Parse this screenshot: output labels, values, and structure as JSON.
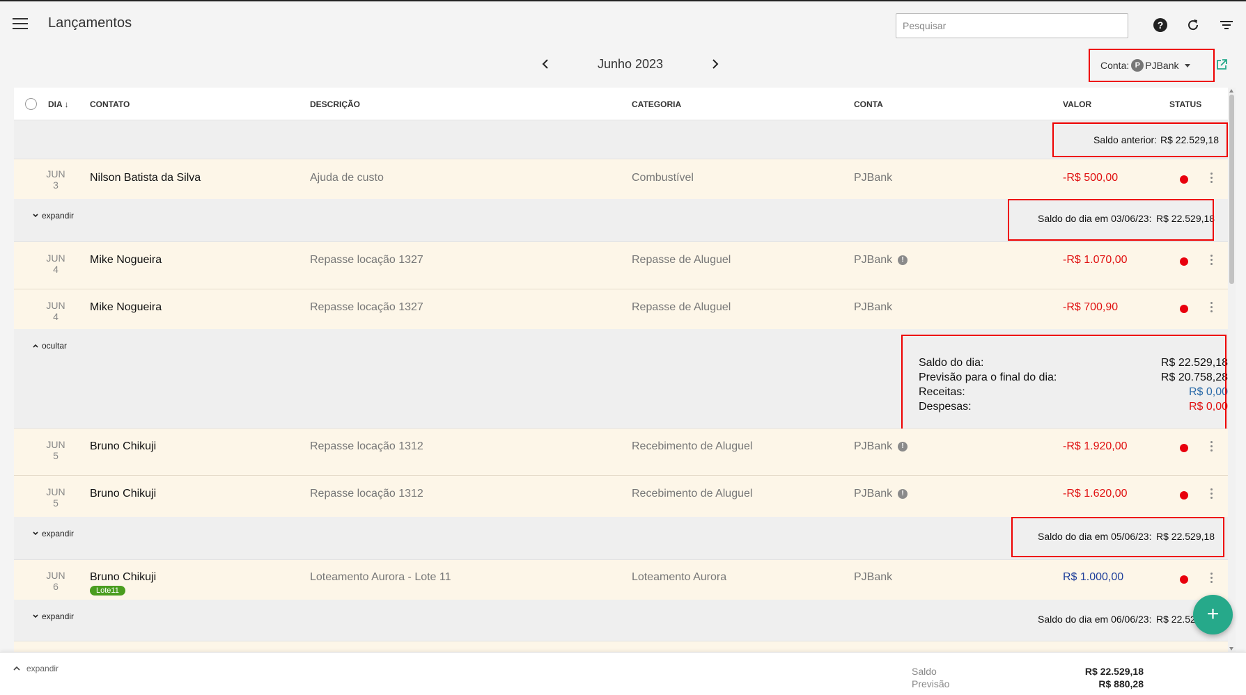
{
  "header": {
    "title": "Lançamentos",
    "search_placeholder": "Pesquisar",
    "icons": [
      "menu-icon",
      "help-icon",
      "refresh-icon",
      "filter-icon"
    ]
  },
  "period": {
    "month": "Junho 2023"
  },
  "account": {
    "label": "Conta:",
    "bank": "PJBank",
    "logo_letter": "P"
  },
  "columns": {
    "dia": "DIA",
    "contato": "CONTATO",
    "descricao": "DESCRIÇÃO",
    "categoria": "CATEGORIA",
    "conta": "CONTA",
    "valor": "VALOR",
    "status": "STATUS"
  },
  "saldo_anterior": {
    "label": "Saldo anterior:",
    "value": "R$ 22.529,18"
  },
  "entries": [
    {
      "month": "JUN",
      "day": "3",
      "contato": "Nilson Batista da Silva",
      "descricao": "Ajuda de custo",
      "categoria": "Combustível",
      "conta": "PJBank",
      "valor": "-R$ 500,00"
    },
    {
      "month": "JUN",
      "day": "4",
      "contato": "Mike Nogueira",
      "descricao": "Repasse locação 1327",
      "categoria": "Repasse de Aluguel",
      "conta": "PJBank",
      "valor": "-R$ 1.070,00"
    },
    {
      "month": "JUN",
      "day": "4",
      "contato": "Mike Nogueira",
      "descricao": "Repasse locação 1327",
      "categoria": "Repasse de Aluguel",
      "conta": "PJBank",
      "valor": "-R$ 700,90"
    },
    {
      "month": "JUN",
      "day": "5",
      "contato": "Bruno Chikuji",
      "descricao": "Repasse locação 1312",
      "categoria": "Recebimento de Aluguel",
      "conta": "PJBank",
      "valor": "-R$ 1.920,00"
    },
    {
      "month": "JUN",
      "day": "5",
      "contato": "Bruno Chikuji",
      "descricao": "Repasse locação 1312",
      "categoria": "Recebimento de Aluguel",
      "conta": "PJBank",
      "valor": "-R$ 1.620,00"
    },
    {
      "month": "JUN",
      "day": "6",
      "contato": "Bruno Chikuji",
      "tag": "Lote11",
      "descricao": "Loteamento Aurora - Lote 11",
      "categoria": "Loteamento Aurora",
      "conta": "PJBank",
      "valor": "R$ 1.000,00"
    }
  ],
  "daily": {
    "expand_label": "expandir",
    "collapse_label": "ocultar",
    "d0306": {
      "label": "Saldo do dia em 03/06/23:",
      "value": "R$ 22.529,18"
    },
    "d0506": {
      "label": "Saldo do dia em 05/06/23:",
      "value": "R$ 22.529,18"
    },
    "d0606": {
      "label": "Saldo do dia em 06/06/23:",
      "value": "R$ 22.52"
    },
    "summary": {
      "saldo_label": "Saldo do dia:",
      "saldo_value": "R$ 22.529,18",
      "previsao_label": "Previsão para o final do dia:",
      "previsao_value": "R$ 20.758,28",
      "receitas_label": "Receitas:",
      "receitas_value": "R$ 0,00",
      "despesas_label": "Despesas:",
      "despesas_value": "R$ 0,00"
    }
  },
  "footer": {
    "expand_label": "expandir",
    "saldo_label": "Saldo",
    "saldo_value": "R$ 22.529,18",
    "previsao_label": "Previsão",
    "previsao_value": "R$ 880,28"
  },
  "colors": {
    "negative": "#e01010",
    "positive": "#1e3e9a",
    "status_pending": "#e8000d",
    "fab": "#26a98a",
    "highlight": "#e00000",
    "row_bg": "#fdf6e8"
  }
}
